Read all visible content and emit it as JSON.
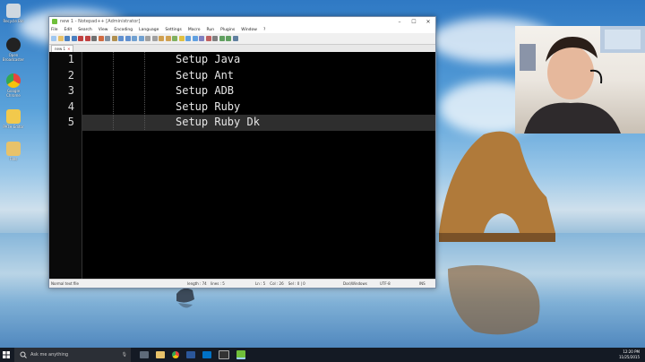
{
  "desktop_icons": [
    {
      "label": "Recycle Bin",
      "color": "#cfd8e0"
    },
    {
      "label": "Open Broadcaster",
      "color": "#222222"
    },
    {
      "label": "Google Chrome",
      "color": "#e8453c"
    },
    {
      "label": "PATH Editor",
      "color": "#f2c94c"
    },
    {
      "label": "Files",
      "color": "#e8c26a"
    }
  ],
  "window": {
    "title": "new 1 - Notepad++ [Administrator]",
    "menu": [
      "File",
      "Edit",
      "Search",
      "View",
      "Encoding",
      "Language",
      "Settings",
      "Macro",
      "Run",
      "Plugins",
      "Window",
      "?"
    ],
    "tab_label": "new 1",
    "line_numbers": [
      "1",
      "2",
      "3",
      "4",
      "5"
    ],
    "lines": [
      "Setup Java",
      "Setup Ant",
      "Setup ADB",
      "Setup Ruby",
      "Setup Ruby Dk"
    ],
    "active_line": 5,
    "status": {
      "filetype": "Normal text file",
      "length": "length : 74",
      "lines": "lines : 5",
      "position": "Ln : 5    Col : 26    Sel : 0 | 0",
      "eol": "Dos\\Windows",
      "encoding": "UTF-8",
      "mode": "INS"
    }
  },
  "taskbar": {
    "search_placeholder": "Ask me anything",
    "time": "12:20 PM",
    "date": "11/25/2015"
  }
}
